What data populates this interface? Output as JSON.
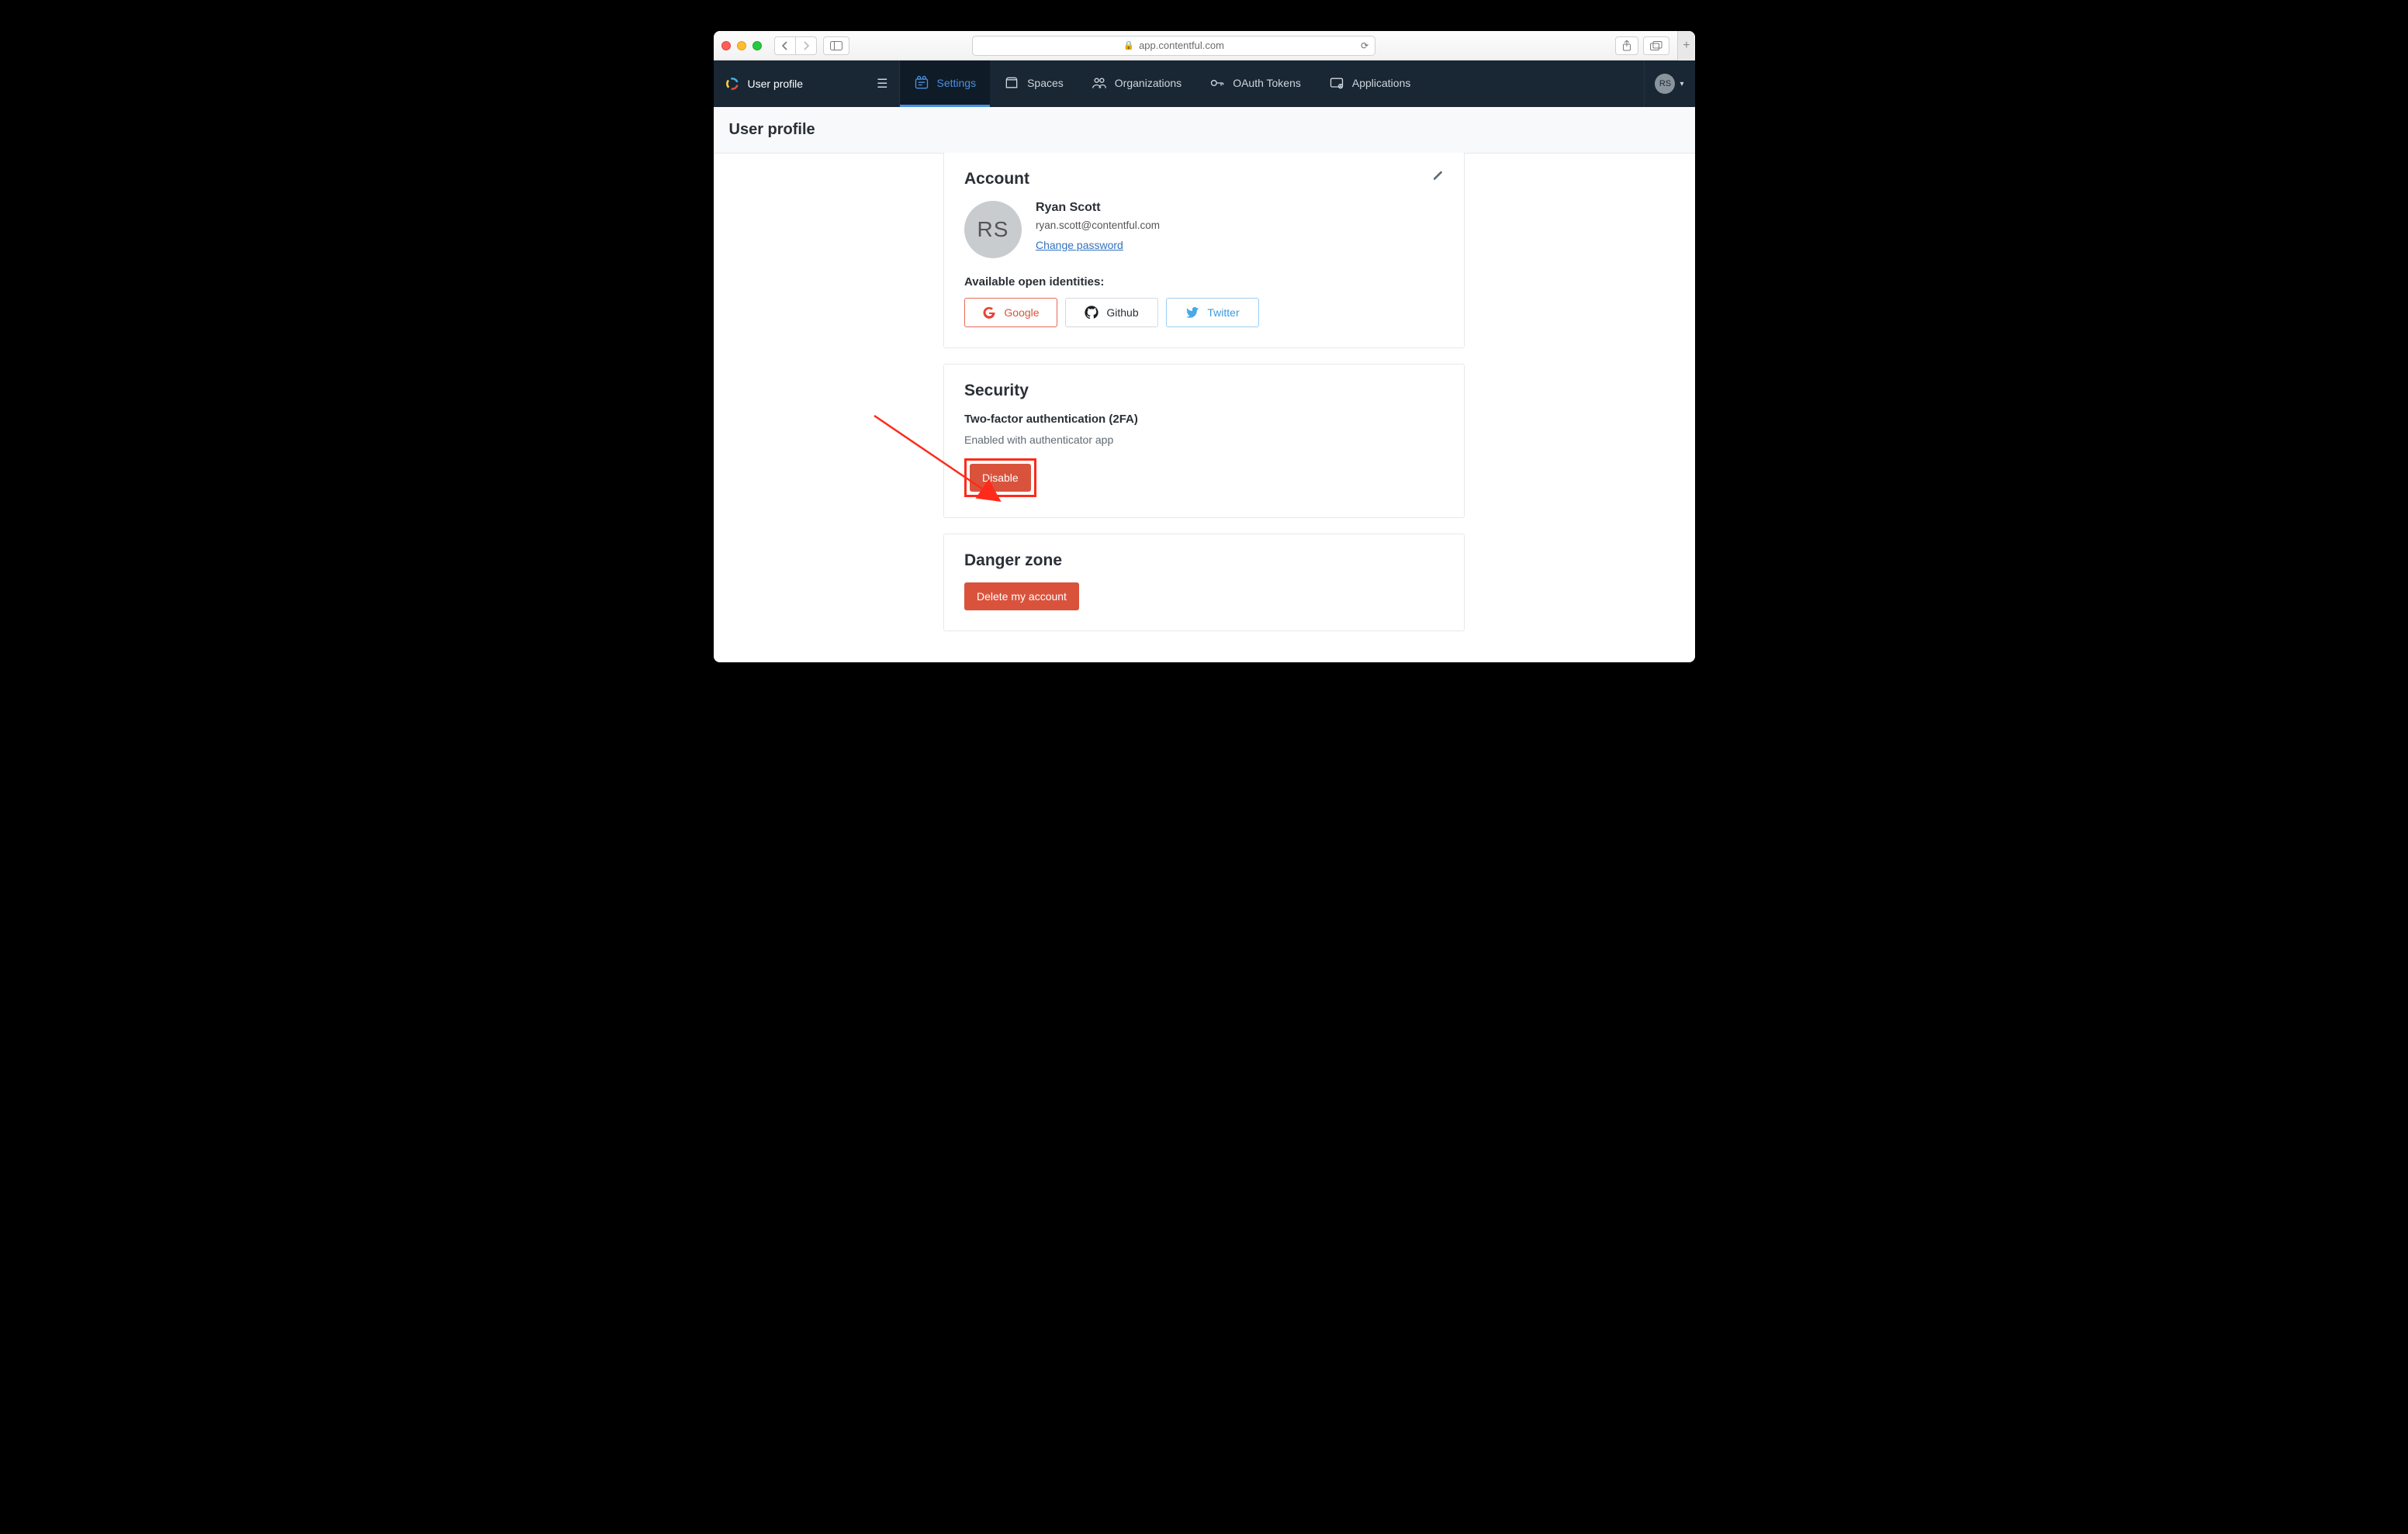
{
  "browser": {
    "url": "app.contentful.com"
  },
  "nav": {
    "branding_title": "User profile",
    "items": [
      {
        "label": "Settings",
        "active": true
      },
      {
        "label": "Spaces",
        "active": false
      },
      {
        "label": "Organizations",
        "active": false
      },
      {
        "label": "OAuth Tokens",
        "active": false
      },
      {
        "label": "Applications",
        "active": false
      }
    ],
    "user_initials": "RS"
  },
  "page": {
    "title": "User profile"
  },
  "account": {
    "heading": "Account",
    "avatar_initials": "RS",
    "name": "Ryan Scott",
    "email": "ryan.scott@contentful.com",
    "change_password_label": "Change password",
    "identities_heading": "Available open identities:",
    "identities": [
      {
        "provider": "Google"
      },
      {
        "provider": "Github"
      },
      {
        "provider": "Twitter"
      }
    ]
  },
  "security": {
    "heading": "Security",
    "subheading": "Two-factor authentication (2FA)",
    "status": "Enabled with authenticator app",
    "disable_label": "Disable"
  },
  "danger": {
    "heading": "Danger zone",
    "delete_label": "Delete my account"
  },
  "colors": {
    "nav_bg": "#192633",
    "accent": "#4a90e2",
    "danger": "#d9533c",
    "annotation": "#ff2a1a"
  }
}
